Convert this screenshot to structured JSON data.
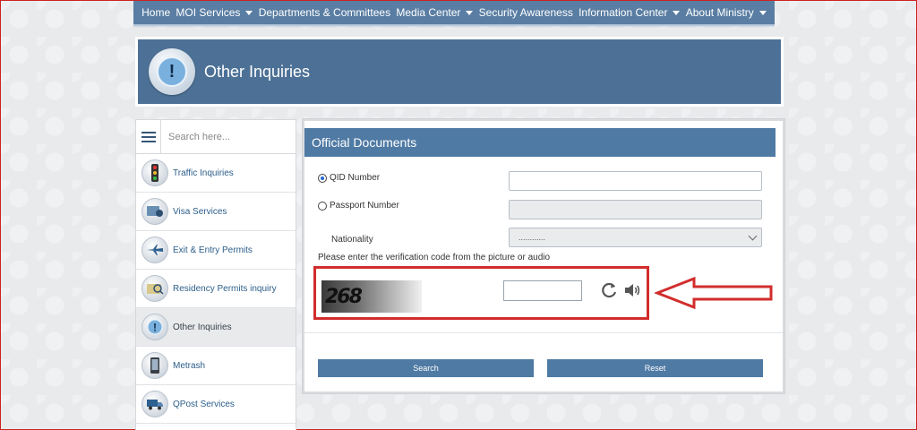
{
  "nav": {
    "items": [
      {
        "label": "Home",
        "dropdown": false
      },
      {
        "label": "MOI Services",
        "dropdown": true
      },
      {
        "label": "Departments & Committees",
        "dropdown": false
      },
      {
        "label": "Media Center",
        "dropdown": true
      },
      {
        "label": "Security Awareness",
        "dropdown": false
      },
      {
        "label": "Information Center",
        "dropdown": true
      },
      {
        "label": "About Ministry",
        "dropdown": true
      }
    ]
  },
  "banner": {
    "title": "Other Inquiries",
    "icon": "exclamation-icon"
  },
  "sidebar": {
    "search_placeholder": "Search here...",
    "items": [
      {
        "label": "Traffic Inquiries",
        "icon": "traffic-light-icon"
      },
      {
        "label": "Visa Services",
        "icon": "visa-icon"
      },
      {
        "label": "Exit & Entry Permits",
        "icon": "airplane-icon"
      },
      {
        "label": "Residency Permits inquiry",
        "icon": "residency-card-icon"
      },
      {
        "label": "Other Inquiries",
        "icon": "exclamation-icon",
        "active": true
      },
      {
        "label": "Metrash",
        "icon": "mobile-phone-icon"
      },
      {
        "label": "QPost Services",
        "icon": "qpost-truck-icon"
      }
    ]
  },
  "form": {
    "title": "Official Documents",
    "qid_label": "QID Number",
    "passport_label": "Passport Number",
    "nationality_label": "Nationality",
    "nationality_value": "............",
    "verification_text": "Please enter the verification code from the picture or audio",
    "captcha_text": "268",
    "search_label": "Search",
    "reset_label": "Reset"
  },
  "colors": {
    "nav": "#5a7ea3",
    "header": "#4f7aa4",
    "highlight": "#d22d2d"
  }
}
